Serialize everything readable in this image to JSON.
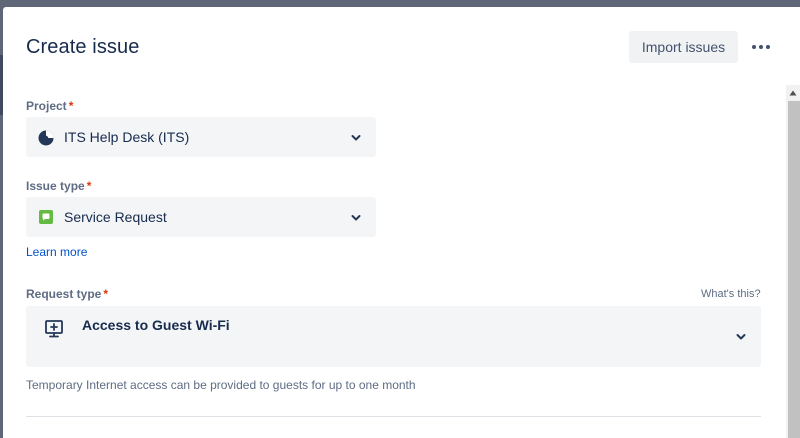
{
  "dialog": {
    "title": "Create issue",
    "import_label": "Import issues",
    "more_icon": "more-horizontal-icon"
  },
  "project": {
    "label": "Project",
    "required": "*",
    "value": "ITS Help Desk (ITS)",
    "icon": "project-avatar-icon"
  },
  "issue_type": {
    "label": "Issue type",
    "required": "*",
    "value": "Service Request",
    "icon": "service-request-icon",
    "icon_color": "#65ba43"
  },
  "learn_more": "Learn more",
  "request_type": {
    "label": "Request type",
    "required": "*",
    "whats_this": "What's this?",
    "value": "Access to Guest Wi-Fi",
    "icon": "monitor-plus-icon",
    "helper": "Temporary Internet access can be provided to guests for up to one month"
  },
  "colors": {
    "link": "#0052cc",
    "required": "#de350b",
    "field_bg": "#f4f5f7"
  }
}
